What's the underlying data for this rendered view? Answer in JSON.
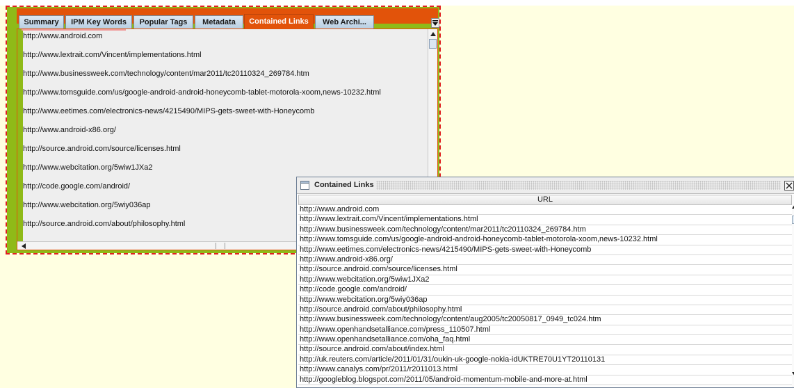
{
  "tabs": [
    {
      "label": "Summary"
    },
    {
      "label": "IPM Key Words"
    },
    {
      "label": "Popular Tags"
    },
    {
      "label": "Metadata"
    },
    {
      "label": "Contained Links",
      "selected": true
    },
    {
      "label": "Web Archi..."
    }
  ],
  "panel_links": [
    "http://www.android.com",
    "http://www.lextrait.com/Vincent/implementations.html",
    "http://www.businessweek.com/technology/content/mar2011/tc20110324_269784.htm",
    "http://www.tomsguide.com/us/google-android-android-honeycomb-tablet-motorola-xoom,news-10232.html",
    "http://www.eetimes.com/electronics-news/4215490/MIPS-gets-sweet-with-Honeycomb",
    "http://www.android-x86.org/",
    "http://source.android.com/source/licenses.html",
    "http://www.webcitation.org/5wiw1JXa2",
    "http://code.google.com/android/",
    "http://www.webcitation.org/5wiy036ap",
    "http://source.android.com/about/philosophy.html"
  ],
  "popup": {
    "title": "Contained Links",
    "column_header": "URL",
    "rows": [
      "http://www.android.com",
      "http://www.lextrait.com/Vincent/implementations.html",
      "http://www.businessweek.com/technology/content/mar2011/tc20110324_269784.htm",
      "http://www.tomsguide.com/us/google-android-android-honeycomb-tablet-motorola-xoom,news-10232.html",
      "http://www.eetimes.com/electronics-news/4215490/MIPS-gets-sweet-with-Honeycomb",
      "http://www.android-x86.org/",
      "http://source.android.com/source/licenses.html",
      "http://www.webcitation.org/5wiw1JXa2",
      "http://code.google.com/android/",
      "http://www.webcitation.org/5wiy036ap",
      "http://source.android.com/about/philosophy.html",
      "http://www.businessweek.com/technology/content/aug2005/tc20050817_0949_tc024.htm",
      "http://www.openhandsetalliance.com/press_110507.html",
      "http://www.openhandsetalliance.com/oha_faq.html",
      "http://source.android.com/about/index.html",
      "http://uk.reuters.com/article/2011/01/31/oukin-uk-google-nokia-idUKTRE70U1YT20110131",
      "http://www.canalys.com/pr/2011/r2011013.html",
      "http://googleblog.blogspot.com/2011/05/android-momentum-mobile-and-more-at.html"
    ]
  },
  "colors": {
    "background": "#ffffe1",
    "panel_green": "#8fba18",
    "tab_selected": "#e2530a",
    "dashed_outline": "#e02020"
  },
  "icons": {
    "tab_menu": "tab-list-dropdown-icon",
    "window": "window-icon",
    "close": "close-icon"
  }
}
